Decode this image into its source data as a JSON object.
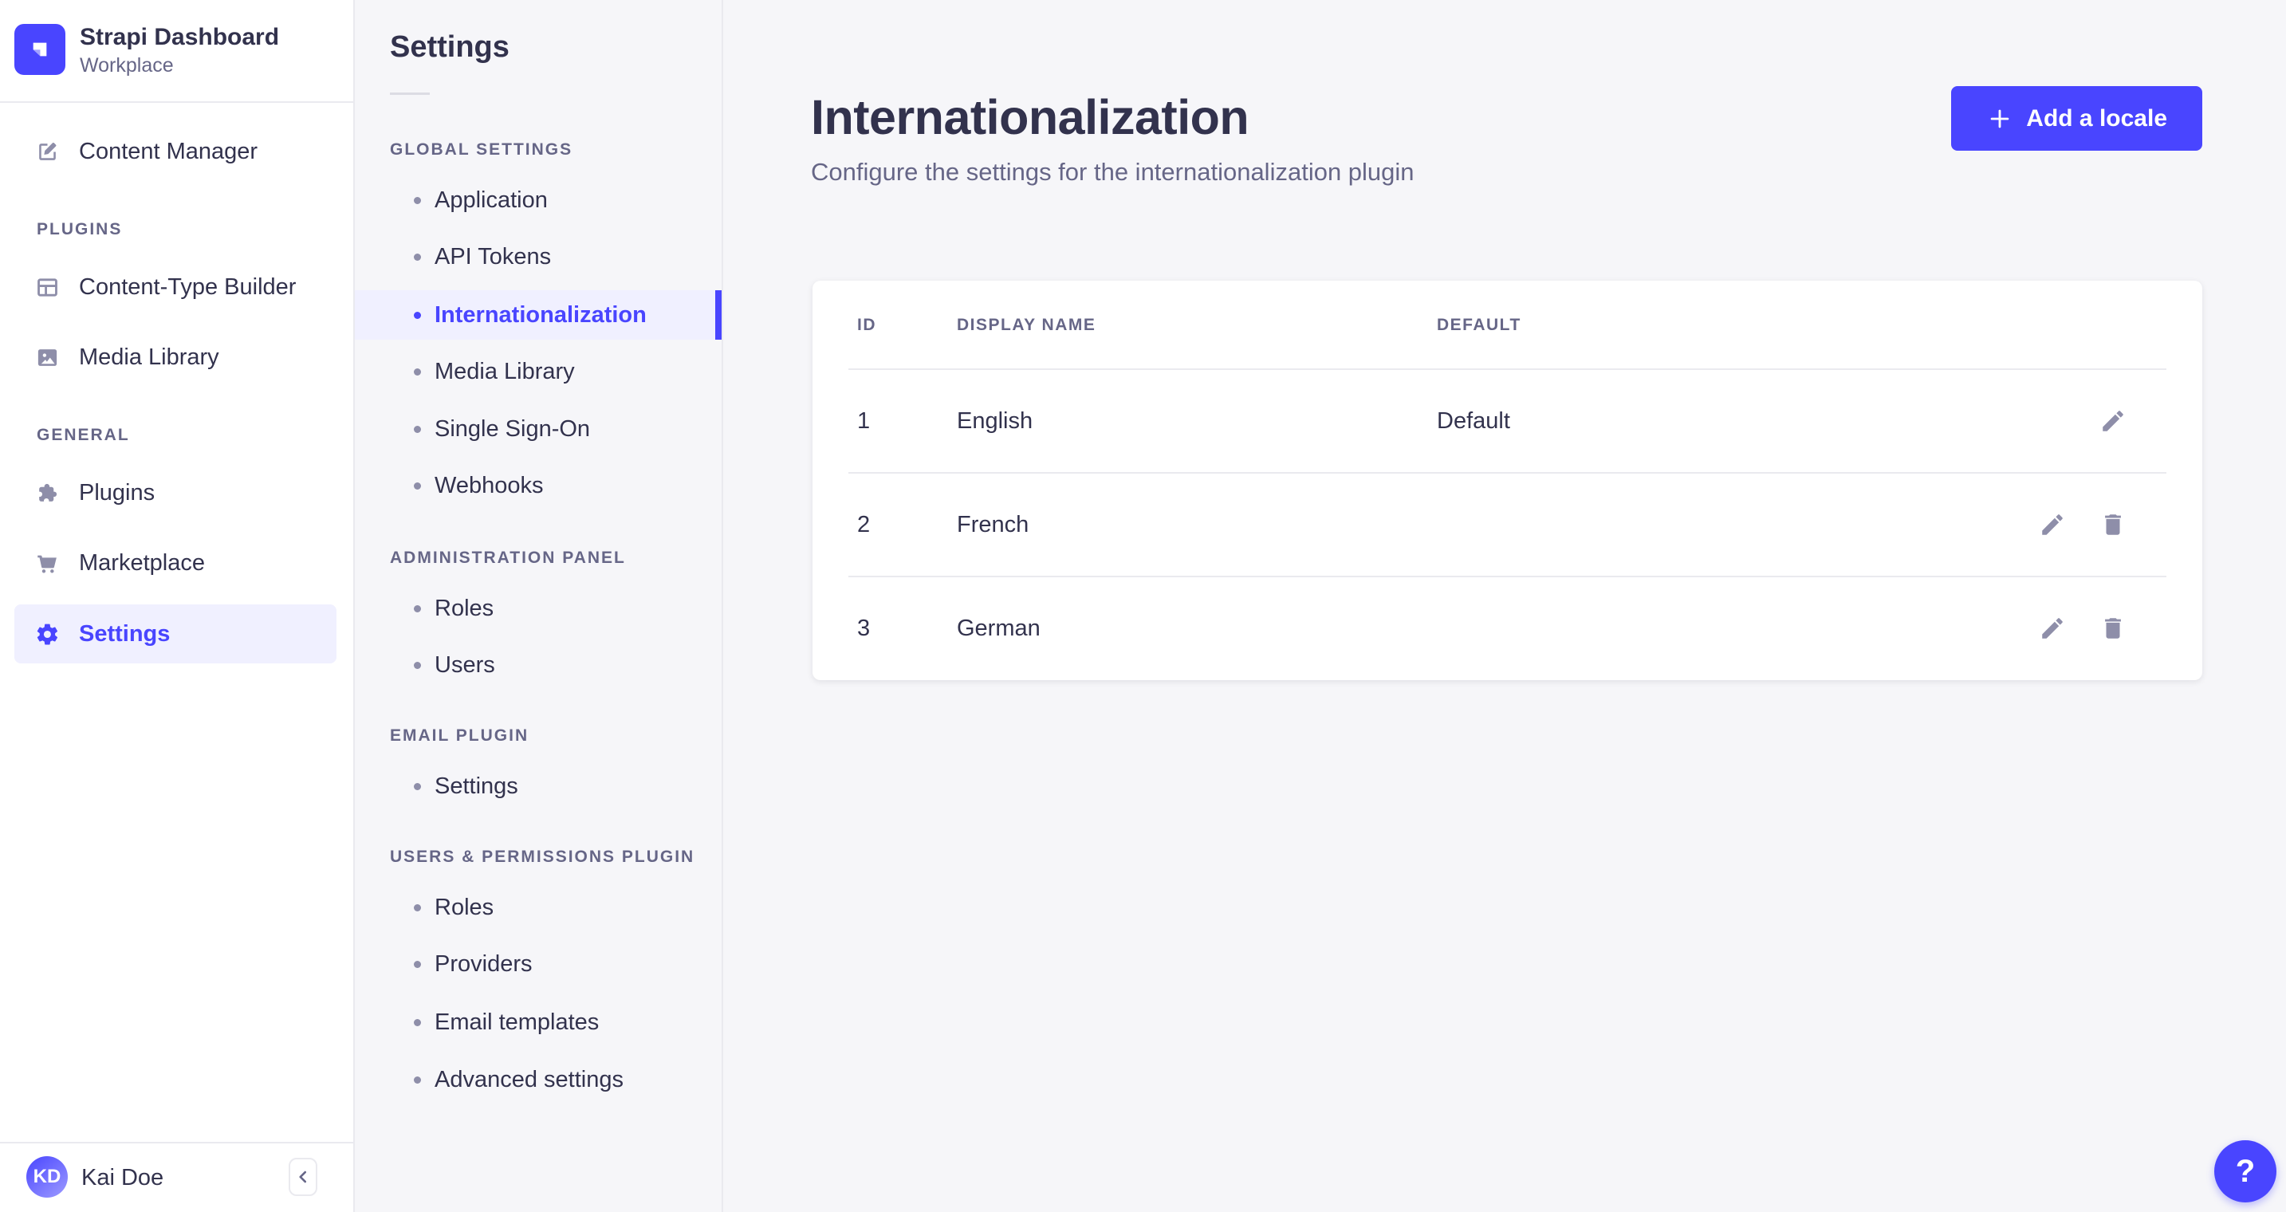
{
  "colors": {
    "primary": "#4945ff",
    "primary_light": "#f0f0ff",
    "page_bg": "#f6f6f9",
    "surface": "#ffffff",
    "border": "#eaeaef",
    "text": "#32324d",
    "text_muted": "#666687",
    "icon_muted": "#8e8ea9"
  },
  "brand": {
    "title": "Strapi Dashboard",
    "subtitle": "Workplace"
  },
  "main_nav": {
    "content_manager": "Content Manager",
    "sections": [
      {
        "header": "PLUGINS",
        "items": [
          {
            "label": "Content-Type Builder"
          },
          {
            "label": "Media Library"
          }
        ]
      },
      {
        "header": "GENERAL",
        "items": [
          {
            "label": "Plugins"
          },
          {
            "label": "Marketplace"
          },
          {
            "label": "Settings"
          }
        ]
      }
    ],
    "active_item": "Settings",
    "user": {
      "initials": "KD",
      "name": "Kai Doe"
    },
    "collapse_icon": "chevron-left"
  },
  "subnav": {
    "title": "Settings",
    "groups": [
      {
        "header": "GLOBAL SETTINGS",
        "items": [
          "Application",
          "API Tokens",
          "Internationalization",
          "Media Library",
          "Single Sign-On",
          "Webhooks"
        ]
      },
      {
        "header": "ADMINISTRATION PANEL",
        "items": [
          "Roles",
          "Users"
        ]
      },
      {
        "header": "EMAIL PLUGIN",
        "items": [
          "Settings"
        ]
      },
      {
        "header": "USERS & PERMISSIONS PLUGIN",
        "items": [
          "Roles",
          "Providers",
          "Email templates",
          "Advanced settings"
        ]
      }
    ],
    "active_item": "Internationalization"
  },
  "page": {
    "title": "Internationalization",
    "subtitle": "Configure the settings for the internationalization plugin",
    "add_locale_button": "Add a locale"
  },
  "locales_table": {
    "headers": {
      "id": "ID",
      "display_name": "DISPLAY NAME",
      "default": "DEFAULT"
    },
    "rows": [
      {
        "id": "1",
        "display_name": "English",
        "default_label": "Default"
      },
      {
        "id": "2",
        "display_name": "French",
        "default_label": ""
      },
      {
        "id": "3",
        "display_name": "German",
        "default_label": ""
      }
    ]
  },
  "help_button": {
    "label": "?"
  }
}
